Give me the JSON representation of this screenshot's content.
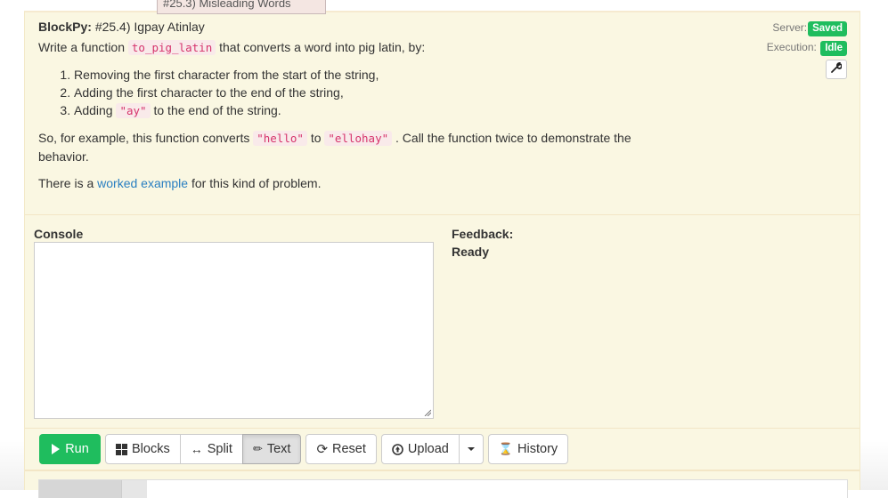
{
  "tooltip_above": "#25.3) Misleading Words",
  "header": {
    "app_label": "BlockPy:",
    "assignment_title": "#25.4) Igpay Atinlay"
  },
  "instructions": {
    "intro_before": "Write a function",
    "function_name": "to_pig_latin",
    "intro_after": "that converts a word into pig latin, by:",
    "steps": [
      {
        "text": "Removing the first character from the start of the string,"
      },
      {
        "text_before": "Adding the first character to the end of the string,"
      },
      {
        "before": "Adding",
        "code": "\"ay\"",
        "after": "to the end of the string."
      }
    ],
    "example_before": "So, for example, this function converts",
    "example_input": "\"hello\"",
    "example_mid": "to",
    "example_output": "\"ellohay\"",
    "example_after": ". Call the function twice to demonstrate the behavior.",
    "worked_before": "There is a",
    "worked_link": "worked example",
    "worked_after": "for this kind of problem."
  },
  "status": {
    "server_label": "Server:",
    "server_value": "Saved",
    "execution_label": "Execution:",
    "execution_value": "Idle",
    "badge_color": "#1fbd5e",
    "settings_icon": "wrench-icon"
  },
  "console": {
    "label": "Console",
    "content": ""
  },
  "feedback": {
    "label": "Feedback:",
    "status": "Ready"
  },
  "toolbar": {
    "run_label": "Run",
    "run_color": "#1fbd5e",
    "blocks_label": "Blocks",
    "split_label": "Split",
    "text_label": "Text",
    "active_mode": "Text",
    "reset_label": "Reset",
    "upload_label": "Upload",
    "history_label": "History"
  }
}
